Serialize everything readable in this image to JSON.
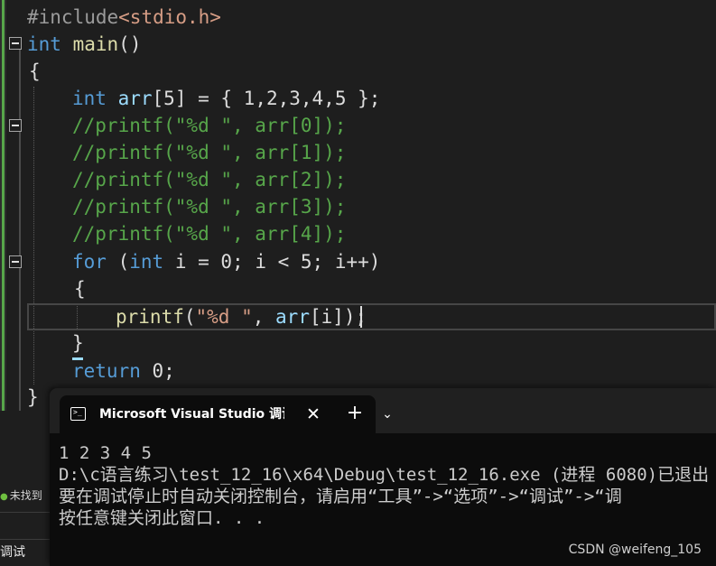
{
  "editor": {
    "lines": {
      "include_kw": "#include",
      "include_hdr": "<stdio.h>",
      "main_type": "int",
      "main_name": "main",
      "main_parens": "()",
      "open_brace": "{",
      "arr_type": "int",
      "arr_name": "arr",
      "arr_rest": "[5] = { 1,2,3,4,5 };",
      "comment_0": "//printf(\"%d \", arr[0]);",
      "comment_1": "//printf(\"%d \", arr[1]);",
      "comment_2": "//printf(\"%d \", arr[2]);",
      "comment_3": "//printf(\"%d \", arr[3]);",
      "comment_4": "//printf(\"%d \", arr[4]);",
      "for_kw": "for",
      "for_open": " (",
      "for_int": "int",
      "for_rest": " i = 0; i < 5; i++)",
      "for_brace_open": "{",
      "printf_fn": "printf",
      "printf_open": "(",
      "printf_str": "\"%d \"",
      "printf_sep": ", ",
      "printf_arr": "arr",
      "printf_idx": "[i]);",
      "for_brace_close": "}",
      "return_kw": "return",
      "return_val": " 0;",
      "close_brace": "}"
    }
  },
  "side": {
    "not_found": "未找到",
    "debug_tab": "调试"
  },
  "terminal": {
    "tab_title": "Microsoft Visual Studio 调试控制台",
    "icon_glyph": ">_",
    "close_glyph": "✕",
    "new_tab_glyph": "+",
    "dropdown_glyph": "⌄",
    "output": [
      "1 2 3 4 5",
      "D:\\c语言练习\\test_12_16\\x64\\Debug\\test_12_16.exe (进程 6080)已退出",
      "要在调试停止时自动关闭控制台，请启用“工具”->“选项”->“调试”->“调",
      "按任意键关闭此窗口. . ."
    ]
  },
  "watermark": "CSDN @weifeng_105",
  "colors": {
    "keyword": "#569cd6",
    "comment": "#57a64a",
    "string": "#d69d85",
    "function": "#dcdcaa",
    "variable": "#9cdcfe"
  }
}
